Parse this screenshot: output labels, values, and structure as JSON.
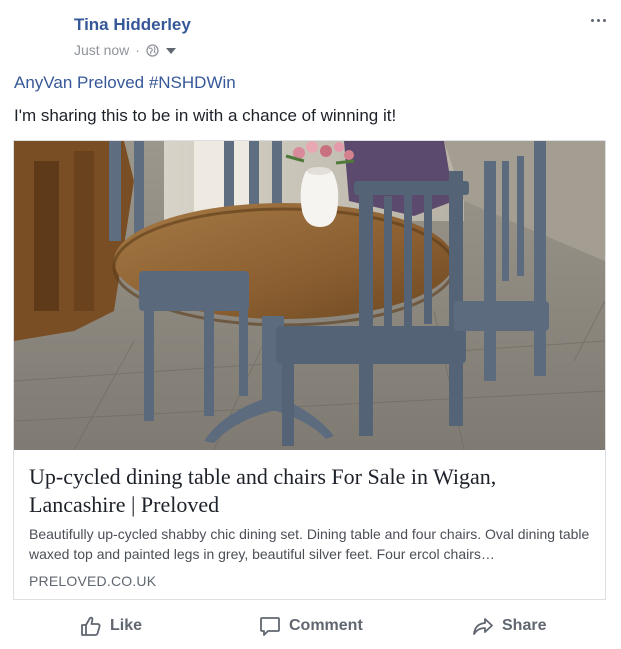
{
  "post": {
    "author": "Tina Hidderley",
    "timestamp": "Just now",
    "separator": "·",
    "privacy_icon": "globe-icon",
    "line1": "AnyVan Preloved #NSHDWin",
    "line2": "I'm sharing this to be in with a chance of winning it!"
  },
  "link_card": {
    "title": "Up-cycled dining table and chairs For Sale in Wigan, Lancashire | Preloved",
    "description": "Beautifully up-cycled shabby chic dining set. Dining table and four chairs. Oval dining table waxed top and painted legs in grey, beautiful silver feet. Four ercol chairs…",
    "domain": "PRELOVED.CO.UK"
  },
  "actions": {
    "like": "Like",
    "comment": "Comment",
    "share": "Share"
  },
  "colors": {
    "link_blue": "#365899",
    "muted_gray": "#606770",
    "border": "#dddfe2"
  }
}
